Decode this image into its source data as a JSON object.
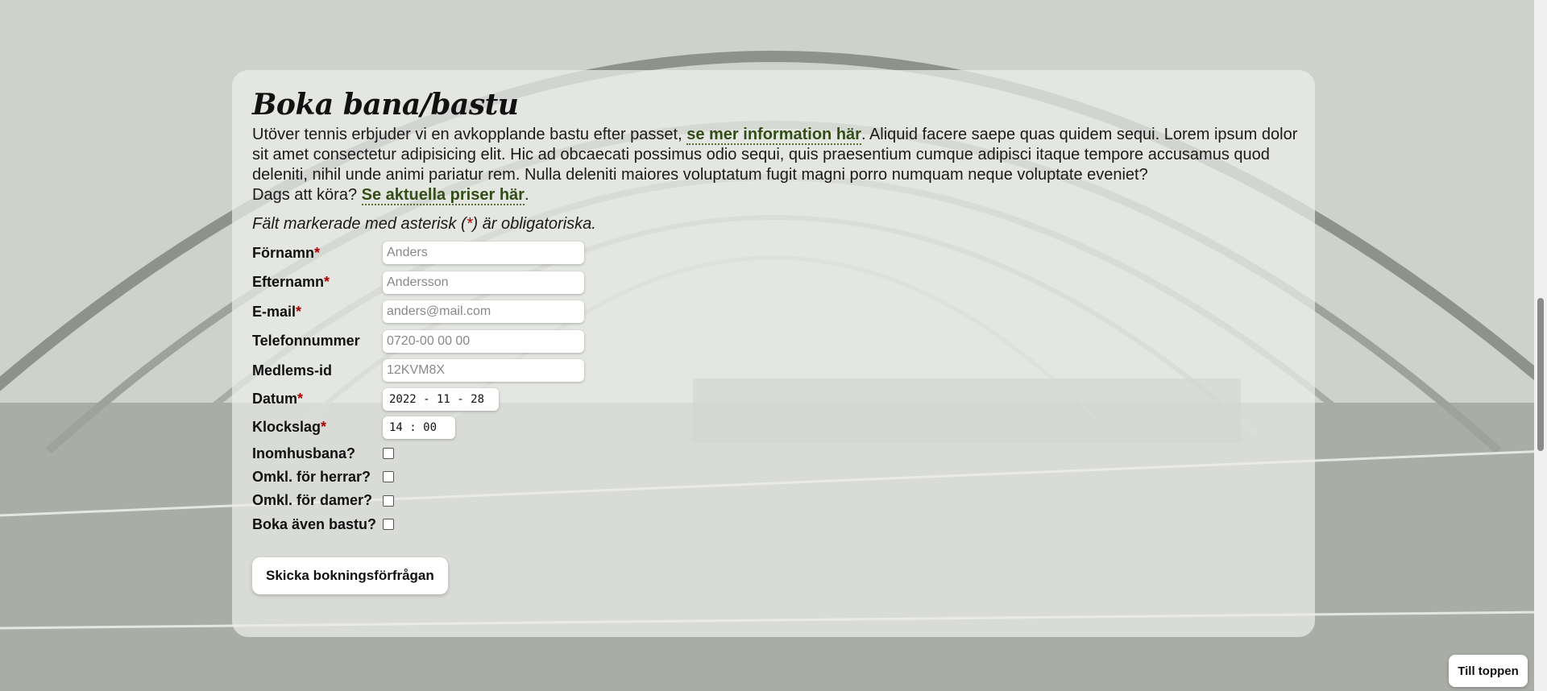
{
  "page": {
    "title": "Boka bana/bastu",
    "intro_text_before_link": "Utöver tennis erbjuder vi en avkopplande bastu efter passet, ",
    "intro_link": "se mer information här",
    "intro_text_after_link": ". Aliquid facere saepe quas quidem sequi. Lorem ipsum dolor sit amet consectetur adipisicing elit. Hic ad obcaecati possimus odio sequi, quis praesentium cumque adipisci itaque tempore accusamus quod deleniti, nihil unde animi pariatur rem. Nulla deleniti maiores voluptatum fugit magni porro numquam neque voluptate eveniet?",
    "prices_text": "Dags att köra? ",
    "prices_link": "Se aktuella priser här",
    "prices_end": ".",
    "required_note_before": "Fält markerade med asterisk (",
    "required_star": "*",
    "required_note_after": ") är obligatoriska."
  },
  "form": {
    "first_name": {
      "label": "Förnamn",
      "required": "*",
      "placeholder": "Anders"
    },
    "last_name": {
      "label": "Efternamn",
      "required": "*",
      "placeholder": "Andersson"
    },
    "email": {
      "label": "E-mail",
      "required": "*",
      "placeholder": "anders@mail.com"
    },
    "phone": {
      "label": "Telefonnummer",
      "placeholder": "0720-00 00 00"
    },
    "member_id": {
      "label": "Medlems-id",
      "placeholder": "12KVM8X"
    },
    "date": {
      "label": "Datum",
      "required": "*",
      "value": "2022 - 11 - 28"
    },
    "time": {
      "label": "Klockslag",
      "required": "*",
      "value": "14 : 00"
    },
    "indoor": {
      "label": "Inomhusbana?"
    },
    "mens_changing": {
      "label": "Omkl. för herrar?"
    },
    "womens_changing": {
      "label": "Omkl. för damer?"
    },
    "sauna": {
      "label": "Boka även bastu?"
    },
    "submit_label": "Skicka bokningsförfrågan"
  },
  "back_to_top": "Till toppen",
  "colors": {
    "link": "#334d16",
    "required": "#aa0000",
    "card": "#ecedea"
  }
}
